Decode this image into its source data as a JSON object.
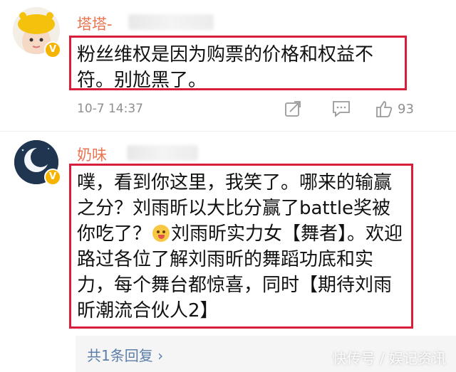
{
  "comments": [
    {
      "username": "塔塔-",
      "avatar": "girl-with-yellow-hat-avatar",
      "badge": "V",
      "text": "粉丝维权是因为购票的价格和权益不符。别尬黑了。",
      "timestamp": "10-7 14:37",
      "likes": "93"
    },
    {
      "username": "奶味",
      "avatar": "night-sky-moon-avatar",
      "badge": "V",
      "text_before_emoji": "噗，看到你这里，我笑了。哪来的输赢之分？刘雨昕以大比分赢了battle奖被你吃了？",
      "emoji": "tongue-out-emoji",
      "text_after_emoji": "刘雨昕实力女【舞者】。欢迎路过各位了解刘雨昕的舞蹈功底和实力，每个舞台都惊喜，同时【期待刘雨昕潮流合伙人2】"
    }
  ],
  "replies": {
    "label": "共1条回复 ›"
  },
  "watermark": "快传号 / 娱记资讯",
  "colors": {
    "username": "#eb7350",
    "highlight_border": "#d81e3a",
    "reply_link": "#5c7ea8",
    "meta": "#8f8f8f",
    "badge": "#f6b400"
  },
  "icons": [
    "share-icon",
    "comment-icon",
    "like-icon"
  ]
}
